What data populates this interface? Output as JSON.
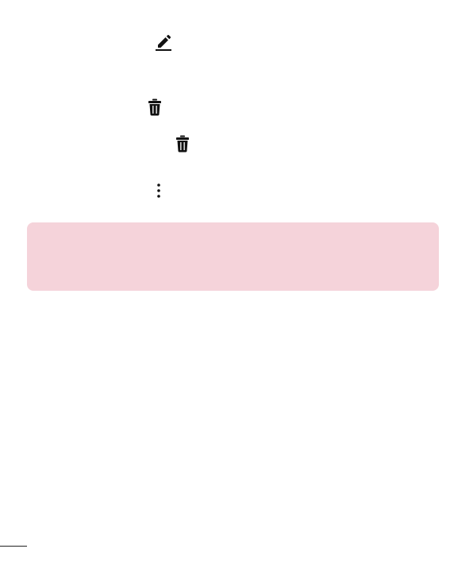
{
  "icons": {
    "edit": "pencil-edit-icon",
    "delete_1": "trash-icon",
    "delete_2": "trash-icon",
    "more": "more-vertical-icon"
  },
  "colors": {
    "note_background": "#f5d3da",
    "icon_color": "#111111"
  }
}
